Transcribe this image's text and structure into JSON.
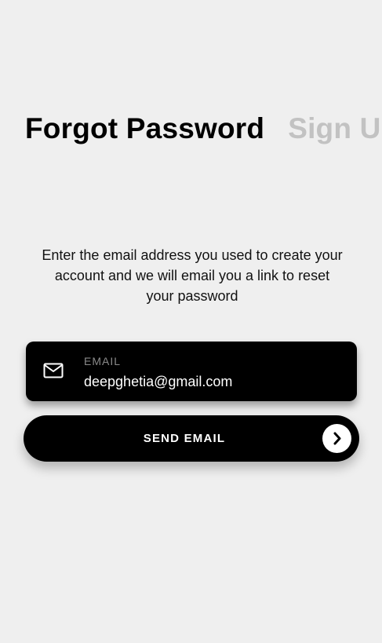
{
  "tabs": {
    "active_label": "Forgot Password",
    "inactive_label": "Sign Up"
  },
  "description": "Enter the email address you used to create your account and we will email you a link to reset your password",
  "email_field": {
    "label": "EMAIL",
    "value": "deepghetia@gmail.com",
    "icon": "mail-icon"
  },
  "send_button": {
    "label": "SEND EMAIL",
    "icon": "chevron-right-icon"
  }
}
